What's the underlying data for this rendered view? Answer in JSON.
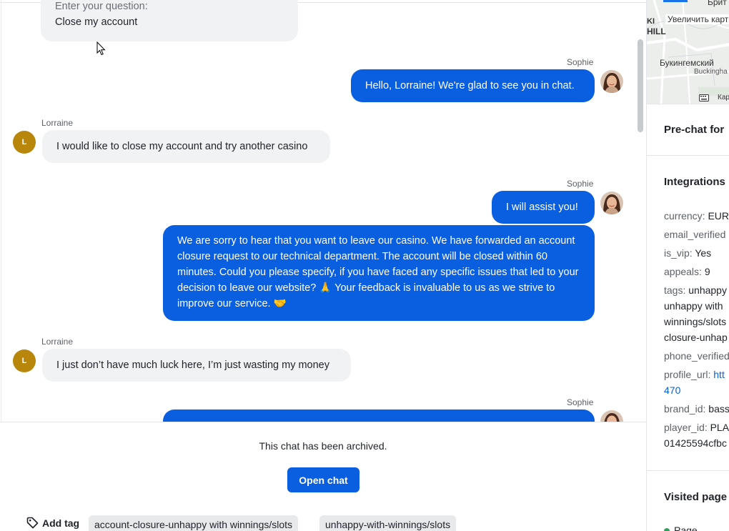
{
  "chat": {
    "top_bubble": {
      "line1": "Enter your question:",
      "line2": "Close my account"
    },
    "messages": [
      {
        "sender": "Sophie",
        "text": "Hello, Lorraine! We're glad to see you in chat."
      },
      {
        "sender": "Lorraine",
        "avatar": "L",
        "text": "I would like to close my account and try another casino"
      },
      {
        "sender": "Sophie",
        "text": "I will assist you!"
      },
      {
        "text": "We are sorry to hear that you want to leave our casino. We have forwarded an account closure request to our technical department. The account will be closed within 60 minutes. Could you please specify, if you have faced any specific issues that led to your decision to leave our website? 🙏 Your feedback is invaluable to us as we strive to improve our service. 🤝"
      },
      {
        "sender": "Lorraine",
        "avatar": "L",
        "text": "I just don’t have much luck here, I’m just wasting my money"
      },
      {
        "sender": "Sophie"
      }
    ]
  },
  "footer": {
    "archived_text": "This chat has been archived.",
    "open_chat_label": "Open chat",
    "add_tag_label": "Add tag",
    "tags": [
      "account-closure-unhappy with winnings/slots",
      "unhappy-with-winnings/slots"
    ]
  },
  "sidebar": {
    "map": {
      "label_top": "Брит",
      "zoom_hint": "Увеличить карт",
      "area": "HILL",
      "area2": "KI",
      "place": "Букингемский",
      "place_en": "Buckingha",
      "attribution": "Кар"
    },
    "prechat_title": "Pre-chat for",
    "integrations_title": "Integrations",
    "fields": [
      {
        "key": "currency:",
        "value": "EUR"
      },
      {
        "key": "email_verified",
        "value": ""
      },
      {
        "key": "is_vip:",
        "value": "Yes"
      },
      {
        "key": "appeals:",
        "value": "9"
      },
      {
        "key": "tags:",
        "value": "unhappy"
      },
      {
        "key": "",
        "value": "unhappy with"
      },
      {
        "key": "",
        "value": "winnings/slots"
      },
      {
        "key": "",
        "value": "closure-unhap"
      },
      {
        "key": "phone_verified",
        "value": ""
      },
      {
        "key": "profile_url:",
        "value": "htt"
      },
      {
        "key": "",
        "value": "470"
      },
      {
        "key": "brand_id:",
        "value": "bass"
      },
      {
        "key": "player_id:",
        "value": "PLA"
      },
      {
        "key": "",
        "value": "01425594cfbc"
      }
    ],
    "visited_title": "Visited page",
    "visited_first": "Page"
  },
  "colors": {
    "accent": "#0a5ee0",
    "lorraine_avatar": "#b8860b"
  },
  "icons": [
    "tag-icon",
    "cursor-icon",
    "keyboard-icon"
  ]
}
